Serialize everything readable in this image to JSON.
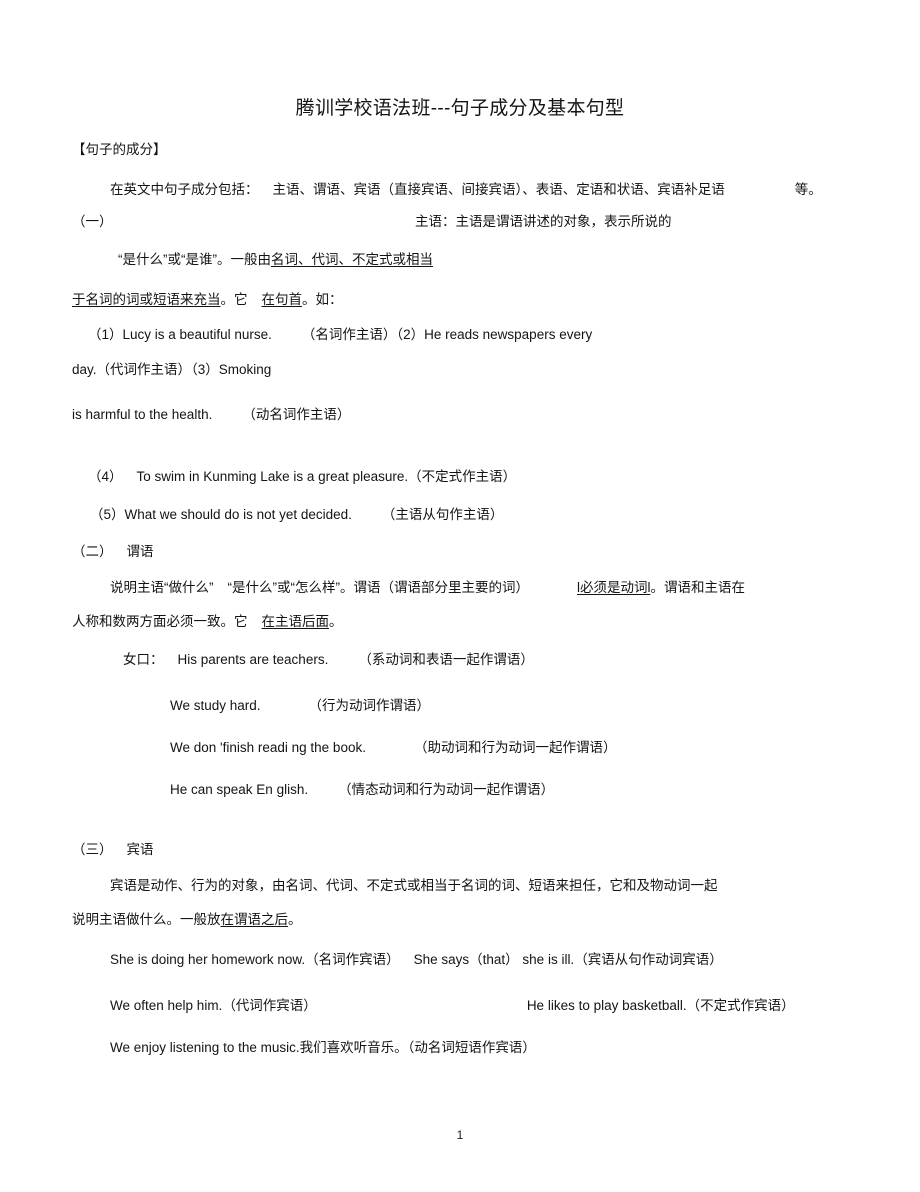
{
  "document": {
    "title": "腾训学校语法班---句子成分及基本句型",
    "page_number": "1"
  },
  "section_heading": "【句子的成分】",
  "intro": {
    "text_main": "在英文中句子成分包括：",
    "text_list": "主语、谓语、宾语（直接宾语、间接宾语）、表语、定语和状语、宾语补足语",
    "text_tail": "等。"
  },
  "subject_section": {
    "label": "（一）",
    "title_right": "主语：主语是谓语讲述的对象，表示所说的",
    "line2_pre": "“是什么”或“是谁”。一般由",
    "line2_underline": "名词、代词、不定式或相当",
    "line3_underline_a": "于名词的词或短语来充当",
    "line3_mid": "。它",
    "line3_underline_b": "在句首",
    "line3_tail": "。如：",
    "examples": [
      {
        "number": "（1）",
        "english": "Lucy is a beautiful nurse.",
        "note": "（名词作主语）",
        "trailing_number": "（2）",
        "trailing_english": "He reads newspapers every"
      },
      {
        "english": "day.",
        "note": "（代词作主语）",
        "trailing_number": "（3）",
        "trailing_english": "Smoking"
      },
      {
        "english": "is harmful to the health.",
        "note": "（动名词作主语）"
      },
      {
        "number": "（4）",
        "english": "To swim in Kunming Lake is a great pleasure.",
        "note": "（不定式作主语）"
      },
      {
        "number": "（5）",
        "english": "What we should do is not yet decided.",
        "note": "（主语从句作主语）"
      }
    ]
  },
  "predicate_section": {
    "label": "（二）",
    "title": "谓语",
    "body_pre": "说明主语“做什么”",
    "body_mid": "“是什么”或“怎么样”。谓语（谓语部分里主要的词）",
    "body_underline": "l必须是动词l",
    "body_tail": "。谓语和主语在",
    "line2_pre": "人称和数两方面必须一致。它",
    "line2_underline": "在主语后面",
    "line2_tail": "。",
    "examples": [
      {
        "prefix": "女口：",
        "english": "His parents are teachers.",
        "note": "（系动词和表语一起作谓语）"
      },
      {
        "english": "We study hard.",
        "note": "（行为动词作谓语）"
      },
      {
        "english": "We don 'finish readi ng the book.",
        "note": "（助动词和行为动词一起作谓语）"
      },
      {
        "english": "He can speak En glish.",
        "note": "（情态动词和行为动词一起作谓语）"
      }
    ]
  },
  "object_section": {
    "label": "（三）",
    "title": "宾语",
    "body_line1": "宾语是动作、行为的对象，由名词、代词、不定式或相当于名词的词、短语来担任，它和及物动词一起",
    "body_line2_pre": "说明主语做什么。一般放",
    "body_line2_underline": "在谓语之后",
    "body_line2_tail": "。",
    "examples": [
      {
        "english": "She is doing her homework now.",
        "note": "（名词作宾语）",
        "english2": "She says（that） she is ill.",
        "note2": "（宾语从句作动词宾语）"
      },
      {
        "english": "We often help him.",
        "note": "（代词作宾语）",
        "english2": "He likes to play basketball.",
        "note2": "（不定式作宾语）"
      },
      {
        "english": "We enjoy listening to the music.我们喜欢听音乐。",
        "note": "（动名词短语作宾语）"
      }
    ]
  }
}
